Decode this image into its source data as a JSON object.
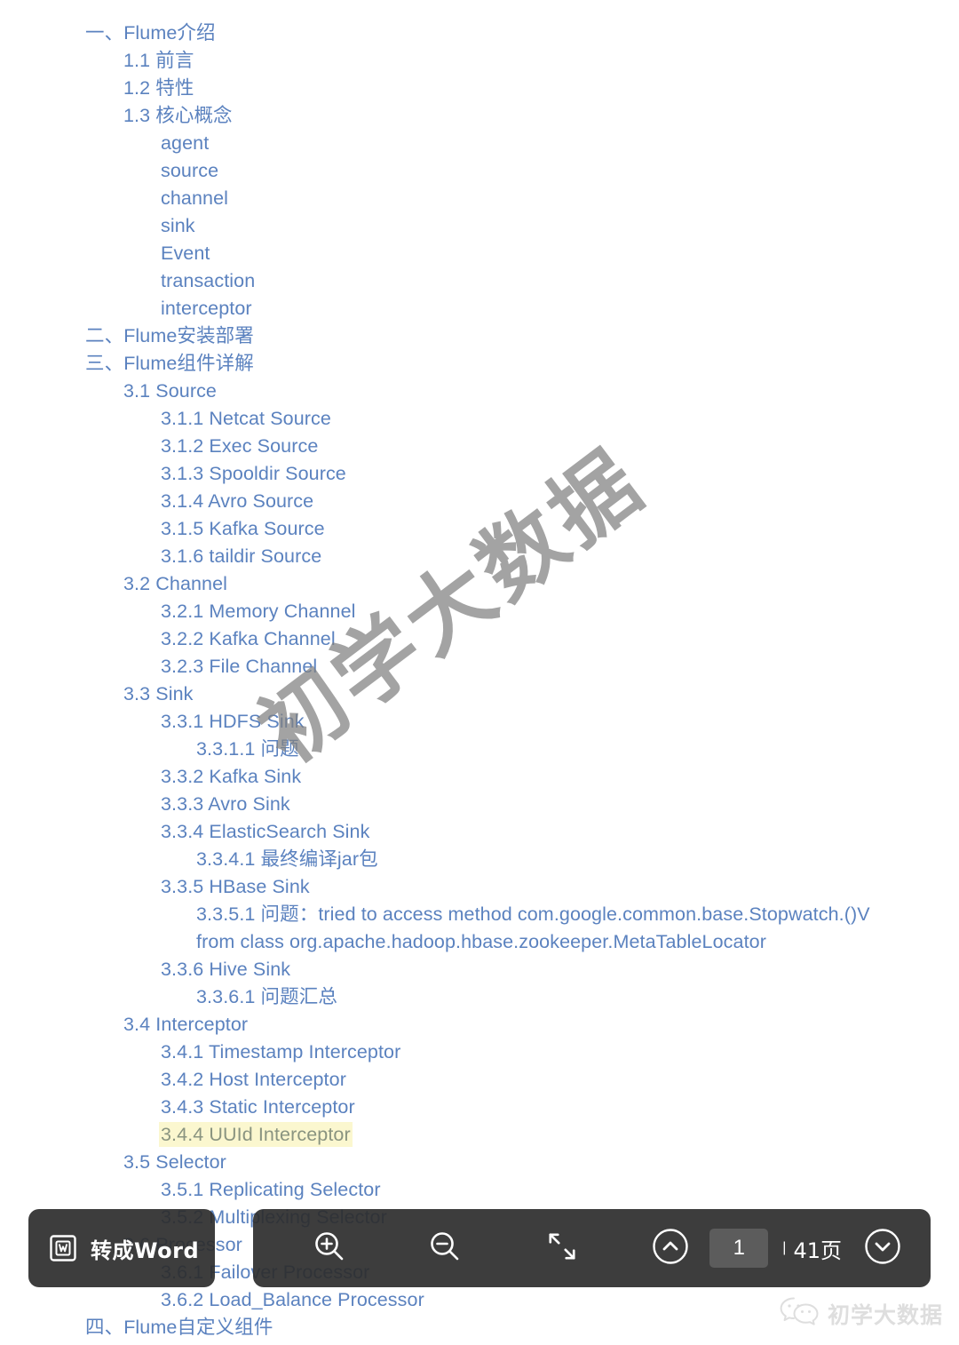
{
  "document": {
    "type": "table-of-contents",
    "toc": [
      {
        "text": "一、Flume介绍",
        "level": 0
      },
      {
        "text": "1.1 前言",
        "level": 1
      },
      {
        "text": "1.2 特性",
        "level": 1
      },
      {
        "text": "1.3 核心概念",
        "level": 1
      },
      {
        "text": "agent",
        "level": 2
      },
      {
        "text": "source",
        "level": 2
      },
      {
        "text": "channel",
        "level": 2
      },
      {
        "text": "sink",
        "level": 2
      },
      {
        "text": "Event",
        "level": 2
      },
      {
        "text": "transaction",
        "level": 2
      },
      {
        "text": "interceptor",
        "level": 2
      },
      {
        "text": "二、Flume安装部署",
        "level": 0
      },
      {
        "text": "三、Flume组件详解",
        "level": 0
      },
      {
        "text": "3.1 Source",
        "level": 1
      },
      {
        "text": "3.1.1 Netcat Source",
        "level": 2
      },
      {
        "text": "3.1.2 Exec Source",
        "level": 2
      },
      {
        "text": "3.1.3 Spooldir Source",
        "level": 2
      },
      {
        "text": "3.1.4 Avro Source",
        "level": 2
      },
      {
        "text": "3.1.5 Kafka Source",
        "level": 2
      },
      {
        "text": "3.1.6 taildir Source",
        "level": 2
      },
      {
        "text": "3.2 Channel",
        "level": 1
      },
      {
        "text": "3.2.1 Memory Channel",
        "level": 2
      },
      {
        "text": "3.2.2 Kafka Channel",
        "level": 2
      },
      {
        "text": "3.2.3 File Channel",
        "level": 2
      },
      {
        "text": "3.3 Sink",
        "level": 1
      },
      {
        "text": "3.3.1 HDFS Sink",
        "level": 2
      },
      {
        "text": "3.3.1.1 问题",
        "level": 3
      },
      {
        "text": "3.3.2 Kafka Sink",
        "level": 2
      },
      {
        "text": "3.3.3 Avro Sink",
        "level": 2
      },
      {
        "text": "3.3.4 ElasticSearch Sink",
        "level": 2
      },
      {
        "text": "3.3.4.1 最终编译jar包",
        "level": 3
      },
      {
        "text": "3.3.5 HBase Sink",
        "level": 2
      },
      {
        "text": "3.3.5.1 问题：tried to access method com.google.common.base.Stopwatch.()V from class org.apache.hadoop.hbase.zookeeper.MetaTableLocator",
        "level": 3,
        "wrap": true
      },
      {
        "text": "3.3.6 Hive Sink",
        "level": 2
      },
      {
        "text": "3.3.6.1 问题汇总",
        "level": 3
      },
      {
        "text": "3.4 Interceptor",
        "level": 1
      },
      {
        "text": "3.4.1 Timestamp Interceptor",
        "level": 2
      },
      {
        "text": "3.4.2 Host Interceptor",
        "level": 2
      },
      {
        "text": "3.4.3 Static Interceptor",
        "level": 2
      },
      {
        "text": "3.4.4 UUId Interceptor",
        "level": 2,
        "highlight": true
      },
      {
        "text": "3.5 Selector",
        "level": 1
      },
      {
        "text": "3.5.1 Replicating Selector",
        "level": 2
      },
      {
        "text": "3.5.2 Multiplexing Selector",
        "level": 2
      },
      {
        "text": "3.6 Processor",
        "level": 1
      },
      {
        "text": "3.6.1 Failover Processor",
        "level": 2
      },
      {
        "text": "3.6.2 Load_Balance Processor",
        "level": 2
      },
      {
        "text": "四、Flume自定义组件",
        "level": 0
      }
    ],
    "link_color": "#5b82bf",
    "highlight_color": "#fbf7cf"
  },
  "watermark": {
    "text": "初学大数据"
  },
  "toolbar": {
    "convert_label": "转成Word",
    "zoom_in_icon": "zoom-in-icon",
    "zoom_out_icon": "zoom-out-icon",
    "fullscreen_icon": "fullscreen-icon",
    "prev_page_icon": "chevron-up-circle-icon",
    "next_page_icon": "chevron-down-circle-icon",
    "page_value": "1",
    "page_separator": "|",
    "page_total": "41页",
    "background_color": "#2d2d2d"
  },
  "brand": {
    "name": "初学大数据",
    "icon": "wechat-icon"
  }
}
